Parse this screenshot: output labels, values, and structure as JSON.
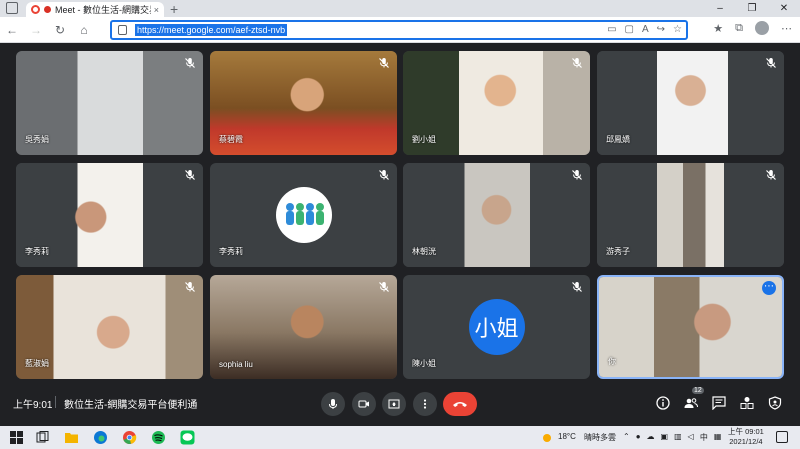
{
  "browser": {
    "tab_title": "Meet - 數位生活-網購交易平",
    "url": "https://meet.google.com/aef-ztsd-nvb",
    "new_tab": "+",
    "close_tab": "×"
  },
  "participants": [
    {
      "name": "吳秀娟",
      "avatar": ""
    },
    {
      "name": "蔡碧霞",
      "avatar": ""
    },
    {
      "name": "劉小姐",
      "avatar": ""
    },
    {
      "name": "邱鳳嬌",
      "avatar": ""
    },
    {
      "name": "李秀莉",
      "avatar": ""
    },
    {
      "name": "李秀莉",
      "avatar": ""
    },
    {
      "name": "林朝洸",
      "avatar": ""
    },
    {
      "name": "游秀子",
      "avatar": ""
    },
    {
      "name": "藍淑娟",
      "avatar": ""
    },
    {
      "name": "sophia liu",
      "avatar": ""
    },
    {
      "name": "陳小姐",
      "avatar": "小姐"
    },
    {
      "name": "你",
      "avatar": ""
    }
  ],
  "meeting": {
    "time": "上午9:01",
    "title": "數位生活-網購交易平台便利通",
    "people_count": "12"
  },
  "taskbar": {
    "temperature": "18°C",
    "weather": "晴時多雲",
    "ime": "中",
    "clock_time": "上午 09:01",
    "clock_date": "2021/12/4"
  },
  "colors": {
    "meet_bg": "#202124",
    "tile_bg": "#3c4043",
    "end_call": "#ea4335",
    "avatar_blue": "#1a73e8",
    "active_border": "#8ab4f8"
  }
}
